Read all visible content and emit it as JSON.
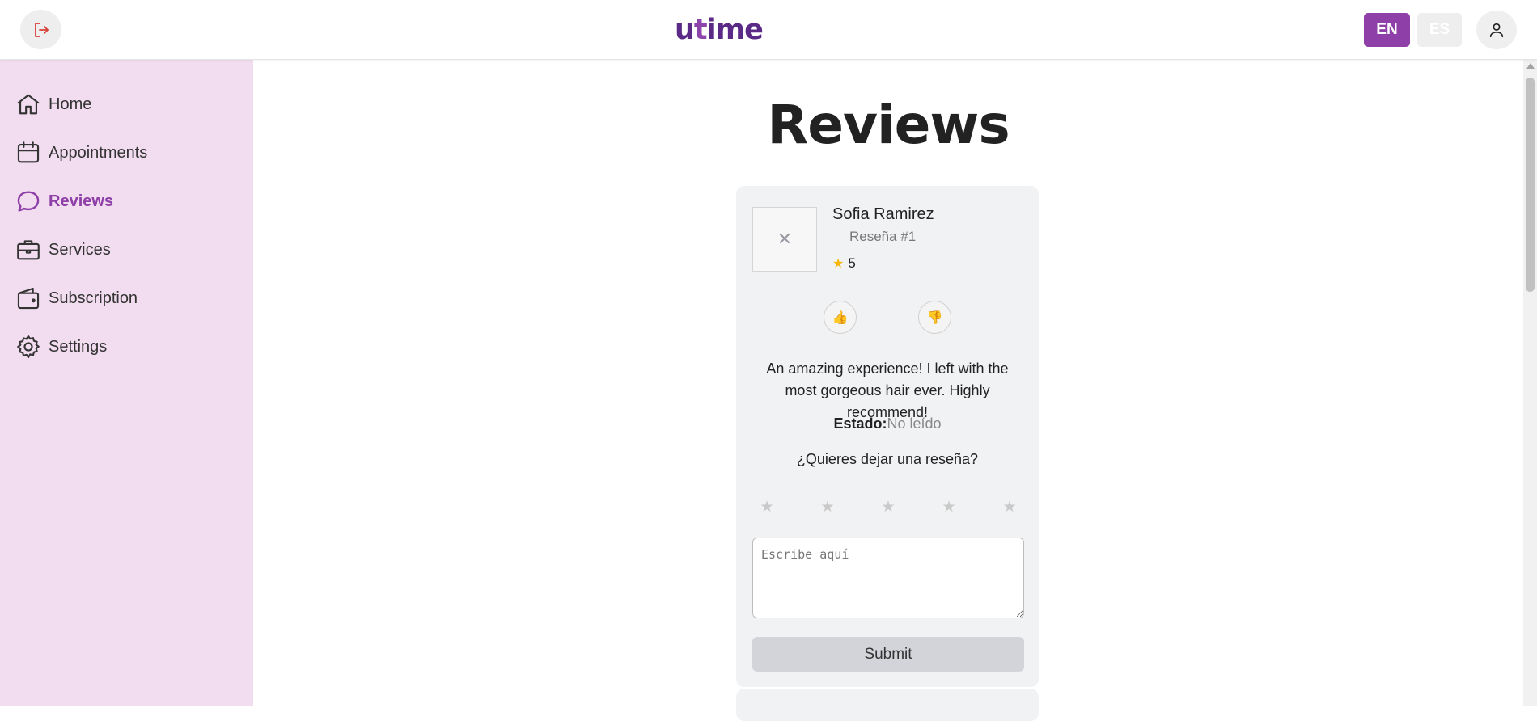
{
  "header": {
    "logo_u": "u",
    "logo_t": "t",
    "logo_rest": "ime",
    "lang_en": "EN",
    "lang_es": "ES",
    "icons": {
      "logout": "logout-icon",
      "user": "user-icon"
    }
  },
  "sidebar": {
    "items": [
      {
        "label": "Home",
        "icon": "home-icon"
      },
      {
        "label": "Appointments",
        "icon": "calendar-icon"
      },
      {
        "label": "Reviews",
        "icon": "chat-bubble-icon",
        "active": true
      },
      {
        "label": "Services",
        "icon": "briefcase-icon"
      },
      {
        "label": "Subscription",
        "icon": "wallet-icon"
      },
      {
        "label": "Settings",
        "icon": "gear-icon"
      }
    ],
    "active_color": "#8e3fa8",
    "background": "#f1ddef"
  },
  "main": {
    "title": "Reviews",
    "review": {
      "avatar_placeholder": "✕",
      "name": "Sofia Ramirez",
      "number": "Reseña #1",
      "rating_star": "★",
      "rating": "5",
      "like_icon": "👍",
      "dislike_icon": "👎",
      "text": "An amazing experience! I left with the most gorgeous hair ever. Highly recommend!",
      "status_label": "Estado:",
      "status_value": "No leído",
      "prompt": "¿Quieres dejar una reseña?",
      "stars": [
        "★",
        "★",
        "★",
        "★",
        "★"
      ],
      "textarea_placeholder": "Escribe aquí",
      "submit_label": "Submit"
    }
  }
}
